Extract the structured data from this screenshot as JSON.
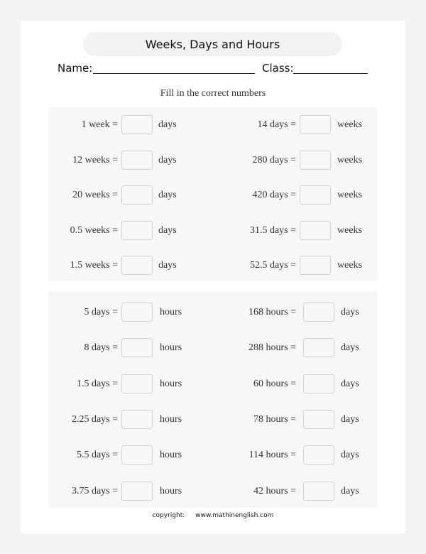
{
  "header": {
    "title": "Weeks, Days and Hours",
    "name_label": "Name:",
    "class_label": "Class:"
  },
  "instructions": "Fill in the correct numbers",
  "sections": [
    {
      "rows": [
        {
          "left": {
            "expr": "1 week  =",
            "unit": "days",
            "answer": ""
          },
          "right": {
            "expr": "14 days  =",
            "unit": "weeks",
            "answer": ""
          }
        },
        {
          "left": {
            "expr": "12 weeks  =",
            "unit": "days",
            "answer": ""
          },
          "right": {
            "expr": "280 days  =",
            "unit": "weeks",
            "answer": ""
          }
        },
        {
          "left": {
            "expr": "20 weeks  =",
            "unit": "days",
            "answer": ""
          },
          "right": {
            "expr": "420 days  =",
            "unit": "weeks",
            "answer": ""
          }
        },
        {
          "left": {
            "expr": "0.5 weeks  =",
            "unit": "days",
            "answer": ""
          },
          "right": {
            "expr": "31.5 days =",
            "unit": "weeks",
            "answer": ""
          }
        },
        {
          "left": {
            "expr": "1.5 weeks  =",
            "unit": "days",
            "answer": ""
          },
          "right": {
            "expr": "52.5 days =",
            "unit": "weeks",
            "answer": ""
          }
        }
      ]
    },
    {
      "rows": [
        {
          "left": {
            "expr": "5 days  =",
            "unit": "hours",
            "answer": ""
          },
          "right": {
            "expr": "168 hours  =",
            "unit": "days",
            "answer": ""
          }
        },
        {
          "left": {
            "expr": "8 days  =",
            "unit": "hours",
            "answer": ""
          },
          "right": {
            "expr": "288 hours  =",
            "unit": "days",
            "answer": ""
          }
        },
        {
          "left": {
            "expr": "1.5 days  =",
            "unit": "hours",
            "answer": ""
          },
          "right": {
            "expr": "60 hours  =",
            "unit": "days",
            "answer": ""
          }
        },
        {
          "left": {
            "expr": "2.25 days  =",
            "unit": "hours",
            "answer": ""
          },
          "right": {
            "expr": "78 hours  =",
            "unit": "days",
            "answer": ""
          }
        },
        {
          "left": {
            "expr": "5.5 days  =",
            "unit": "hours",
            "answer": ""
          },
          "right": {
            "expr": "114 hours  =",
            "unit": "days",
            "answer": ""
          }
        },
        {
          "left": {
            "expr": "3.75 days  =",
            "unit": "hours",
            "answer": ""
          },
          "right": {
            "expr": "42 hours  =",
            "unit": "days",
            "answer": ""
          }
        }
      ]
    }
  ],
  "footer": {
    "copyright_label": "copyright:",
    "website": "www.mathinenglish.com"
  }
}
